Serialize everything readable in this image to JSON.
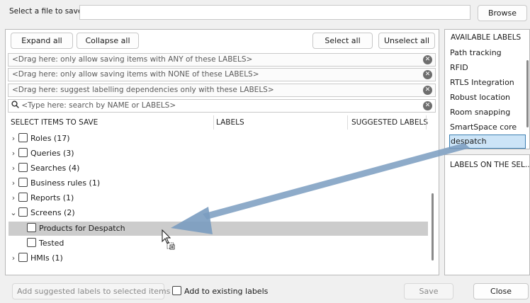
{
  "file": {
    "label": "Select a file to save",
    "value": "",
    "browse": "Browse"
  },
  "toolbar": {
    "expand_all": "Expand all",
    "collapse_all": "Collapse all",
    "select_all": "Select all",
    "unselect_all": "Unselect all"
  },
  "filters": [
    {
      "placeholder": "<Drag here: only allow saving items with ANY of these LABELS>"
    },
    {
      "placeholder": "<Drag here: only allow saving items with NONE of these LABELS>"
    },
    {
      "placeholder": "<Drag here: suggest labelling dependencies only with these LABELS>"
    }
  ],
  "search": {
    "placeholder": "<Type here: search by NAME or LABELS>"
  },
  "columns": {
    "items": "SELECT ITEMS TO SAVE",
    "labels": "LABELS",
    "suggested": "SUGGESTED LABELS"
  },
  "tree": [
    {
      "label": "Roles (17)",
      "expander": "›",
      "checked": false
    },
    {
      "label": "Queries (3)",
      "expander": "›",
      "checked": false
    },
    {
      "label": "Searches (4)",
      "expander": "›",
      "checked": false
    },
    {
      "label": "Business rules (1)",
      "expander": "›",
      "checked": false
    },
    {
      "label": "Reports (1)",
      "expander": "›",
      "checked": false
    },
    {
      "label": "Screens (2)",
      "expander": "⌄",
      "checked": false
    },
    {
      "label": "Products for Despatch",
      "expander": "",
      "checked": false,
      "highlighted": true
    },
    {
      "label": "Tested",
      "expander": "",
      "checked": false
    },
    {
      "label": "HMIs (1)",
      "expander": "›",
      "checked": false
    }
  ],
  "available_labels": {
    "title": "AVAILABLE LABELS",
    "items": [
      "Path tracking",
      "RFID",
      "RTLS Integration",
      "Robust location",
      "Room snapping",
      "SmartSpace core",
      "despatch"
    ],
    "selected": "despatch"
  },
  "labels_on_selection": {
    "title": "LABELS ON THE SEL..."
  },
  "footer": {
    "add_suggested": "Add suggested labels to selected items",
    "add_existing": "Add to existing labels",
    "save": "Save",
    "close": "Close"
  },
  "colors": {
    "highlight_row": "#cccccc",
    "selected_label": "#cce4f7",
    "drag_arrow": "#7a9cc0"
  }
}
